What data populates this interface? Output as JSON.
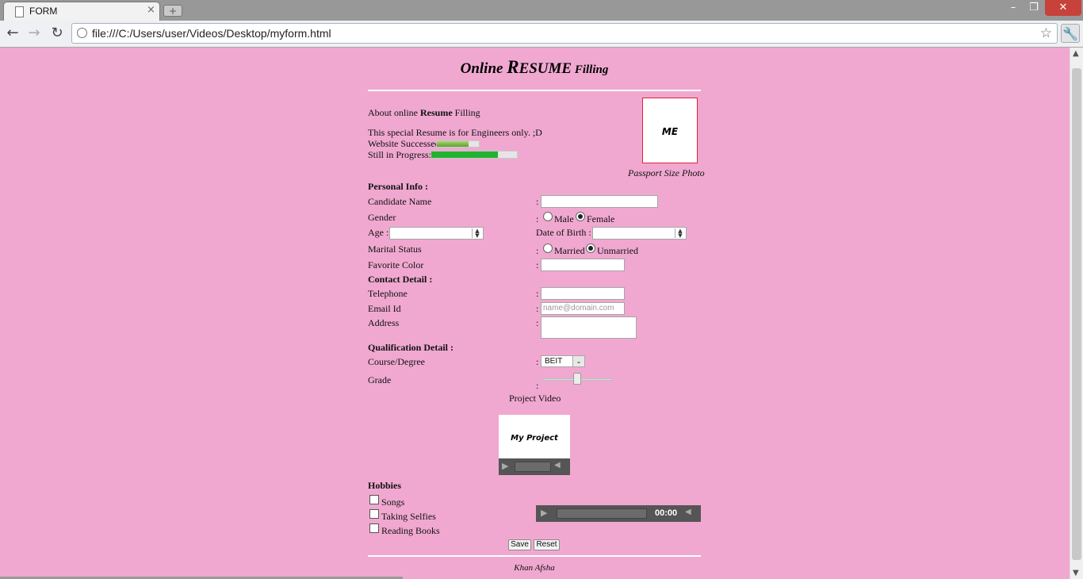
{
  "browser": {
    "tab_title": "FORM",
    "tab_close": "×",
    "new_tab": "+",
    "url": "file:///C:/Users/user/Videos/Desktop/myform.html",
    "window": {
      "minimize": "–",
      "maximize": "❐",
      "close": "✕"
    },
    "nav": {
      "back": "←",
      "forward": "→",
      "reload": "↻"
    },
    "bookmark_icon": "star-icon",
    "menu_icon": "wrench-icon"
  },
  "page": {
    "title": {
      "part1": "Online ",
      "part2": "R",
      "part3": "ESUME",
      "part4": " Filling"
    },
    "about": {
      "prefix": "About online ",
      "bold": "Resume",
      "suffix": " Filling"
    },
    "special_note": "This special Resume is for Engineers only. ;D",
    "website_success_label": "Website Successed",
    "website_success_progress": 0.75,
    "in_progress_label": "Still in Progress:",
    "in_progress_value": 0.78,
    "photo": {
      "text": "ME",
      "caption": "Passport Size Photo"
    },
    "personal_heading": "Personal Info :",
    "candidate_name_label": "Candidate Name",
    "gender_label": "Gender",
    "gender_options": [
      "Male",
      "Female"
    ],
    "gender_selected": "Female",
    "age_label": "Age :",
    "dob_label": "Date of Birth :",
    "marital_label": "Marital Status",
    "marital_options": [
      "Married",
      "Unmarried"
    ],
    "marital_selected": "Unmarried",
    "fav_color_label": "Favorite Color",
    "contact_heading": "Contact Detail :",
    "telephone_label": "Telephone",
    "email_label": "Email Id",
    "email_placeholder": "name@domain.com",
    "address_label": "Address",
    "qualification_heading": "Qualification Detail :",
    "course_label": "Course/Degree",
    "course_selected": "BEIT",
    "grade_label": "Grade",
    "grade_value": 0.5,
    "colon": ":",
    "video_heading": "Project Video",
    "video_title": "My Project",
    "hobbies_heading": "Hobbies",
    "hobbies": [
      "Songs",
      "Taking Selfies",
      "Reading Books"
    ],
    "audio_time": "00:00",
    "save_label": "Save",
    "reset_label": "Reset",
    "footer": "Khan Afsha"
  },
  "colors": {
    "page_bg": "#f0a8d0",
    "progress_green": "#22b232",
    "photo_border": "#e0233b"
  }
}
